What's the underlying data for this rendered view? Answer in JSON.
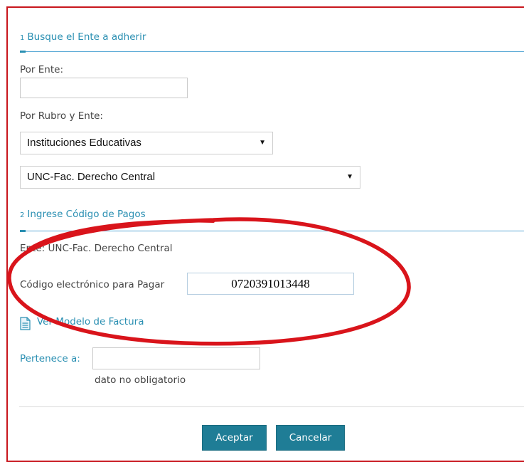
{
  "section1": {
    "number": "1",
    "title": "Busque el Ente a adherir"
  },
  "por_ente": {
    "label": "Por Ente:",
    "value": ""
  },
  "por_rubro": {
    "label": "Por Rubro y Ente:",
    "rubro_selected": "Instituciones Educativas",
    "ente_selected": "UNC-Fac. Derecho Central",
    "arrow": "▼"
  },
  "section2": {
    "number": "2",
    "title": "Ingrese Código de Pagos"
  },
  "ente_info": "Ente: UNC-Fac. Derecho Central",
  "codigo": {
    "label": "Código electrónico para Pagar",
    "value": "0720391013448"
  },
  "modelo_link": "Ver Modelo de Factura",
  "pertenece": {
    "label": "Pertenece a:",
    "value": "",
    "hint": "dato no obligatorio"
  },
  "buttons": {
    "accept": "Aceptar",
    "cancel": "Cancelar"
  },
  "colors": {
    "accent": "#2a8fb2",
    "button": "#1f7d96",
    "annotation": "#d9141b"
  }
}
